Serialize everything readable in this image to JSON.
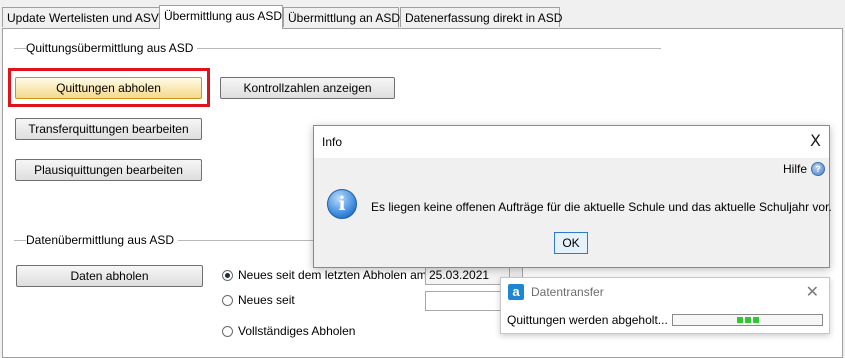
{
  "tabs": [
    {
      "label": "Update Wertelisten und ASV",
      "active": false
    },
    {
      "label": "Übermittlung aus ASD",
      "active": true
    },
    {
      "label": "Übermittlung an ASD",
      "active": false
    },
    {
      "label": "Datenerfassung direkt in ASD",
      "active": false
    }
  ],
  "quittung_section": {
    "title": "Quittungsübermittlung aus ASD",
    "buttons": {
      "quittungen_abholen": "Quittungen abholen",
      "kontrollzahlen": "Kontrollzahlen anzeigen",
      "transferquittungen": "Transferquittungen bearbeiten",
      "plausiquittungen": "Plausiquittungen bearbeiten"
    }
  },
  "daten_section": {
    "title": "Datenübermittlung aus ASD",
    "daten_abholen": "Daten abholen",
    "options": [
      {
        "label": "Neues seit dem letzten Abholen am",
        "selected": true
      },
      {
        "label": "Neues seit",
        "selected": false
      },
      {
        "label": "Vollständiges Abholen",
        "selected": false
      }
    ],
    "last_fetch_date": "25.03.2021",
    "since_date": ""
  },
  "info_dialog": {
    "title": "Info",
    "close": "X",
    "help": "Hilfe",
    "help_icon_glyph": "?",
    "info_icon_glyph": "i",
    "message": "Es liegen keine offenen Aufträge für die aktuelle Schule und das aktuelle Schuljahr vor.",
    "ok": "OK"
  },
  "datentransfer": {
    "title": "Datentransfer",
    "icon_glyph": "a",
    "close": "✕",
    "status": "Quittungen werden abgeholt...",
    "progress_segments": 3
  },
  "colors": {
    "highlight": "#e0121b",
    "accent": "#1f86d1",
    "progress": "#32c832"
  }
}
